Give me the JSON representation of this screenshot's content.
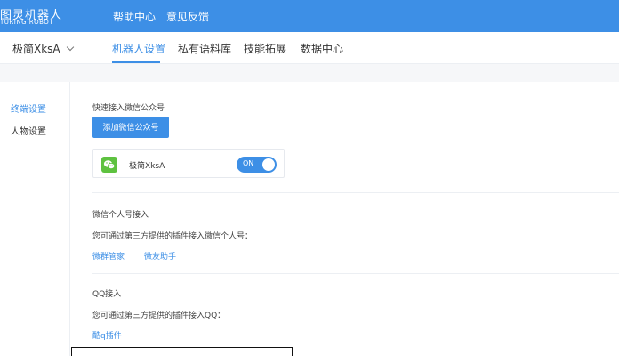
{
  "header": {
    "logo_cn": "图灵机器人",
    "logo_en": "TURING ROBOT",
    "links": [
      "帮助中心",
      "意见反馈"
    ]
  },
  "subnav": {
    "bot_name": "极简XksA",
    "tabs": [
      "机器人设置",
      "私有语料库",
      "技能拓展",
      "数据中心"
    ],
    "active_tab": "机器人设置"
  },
  "sidebar": {
    "items": [
      "终端设置",
      "人物设置"
    ],
    "active": "终端设置"
  },
  "main": {
    "official_section_title": "快速接入微信公众号",
    "add_button": "添加微信公众号",
    "wechat_card": {
      "account_name": "极简XksA",
      "toggle_label": "ON",
      "toggle_on": true
    },
    "personal_section": {
      "title": "微信个人号接入",
      "desc": "您可通过第三方提供的插件接入微信个人号：",
      "links": [
        "微群管家",
        "微友助手"
      ]
    },
    "qq_section": {
      "title": "QQ接入",
      "desc": "您可通过第三方提供的插件接入QQ：",
      "links": [
        "酷q插件"
      ]
    }
  },
  "colors": {
    "primary": "#3d8fe6",
    "wechat_green": "#5ec240",
    "page_gray": "#f6f7f9"
  }
}
